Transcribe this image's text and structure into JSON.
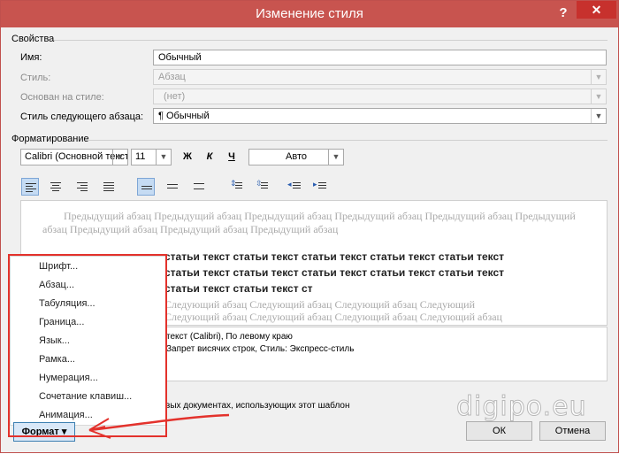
{
  "window": {
    "title": "Изменение стиля",
    "help_glyph": "?",
    "close_glyph": "✕"
  },
  "properties": {
    "section": "Свойства",
    "name_label": "Имя:",
    "name_value": "Обычный",
    "style_label": "Стиль:",
    "style_value": "Абзац",
    "based_label": "Основан на стиле:",
    "based_value": "(нет)",
    "next_label": "Стиль следующего абзаца:",
    "next_value": "¶ Обычный"
  },
  "formatting": {
    "section": "Форматирование",
    "font": "Calibri (Основной текст",
    "size": "11",
    "bold": "Ж",
    "italic": "К",
    "underline": "Ч",
    "color": "Авто"
  },
  "preview": {
    "prev_paragraph": "Предыдущий абзац Предыдущий абзац Предыдущий абзац Предыдущий абзац Предыдущий абзац Предыдущий абзац Предыдущий абзац Предыдущий абзац Предыдущий абзац",
    "main_line1": "статьи текст статьи текст статьи текст статьи текст статьи текст",
    "main_line2": "статьи текст статьи текст статьи текст статьи текст статьи текст",
    "main_line3": "статьи текст статьи текст ст",
    "next_line1": "Следующий абзац Следующий абзац Следующий абзац Следующий",
    "next_line2": "Следующий абзац Следующий абзац Следующий абзац Следующий абзац"
  },
  "description": {
    "line1": "текст (Calibri), По левому краю",
    "line2": "Запрет висячих строк, Стиль: Экспресс-стиль"
  },
  "bottom_text": "вых документах, использующих этот шаблон",
  "menu": {
    "items": [
      "Шрифт...",
      "Абзац...",
      "Табуляция...",
      "Граница...",
      "Язык...",
      "Рамка...",
      "Нумерация...",
      "Сочетание клавиш...",
      "Анимация..."
    ]
  },
  "buttons": {
    "format": "Формат ▾",
    "ok": "ОК",
    "cancel": "Отмена"
  },
  "watermark": "digipo.eu",
  "colors": {
    "titlebar": "#c8544f",
    "close": "#c7312d",
    "highlight_red": "#e3322c"
  }
}
